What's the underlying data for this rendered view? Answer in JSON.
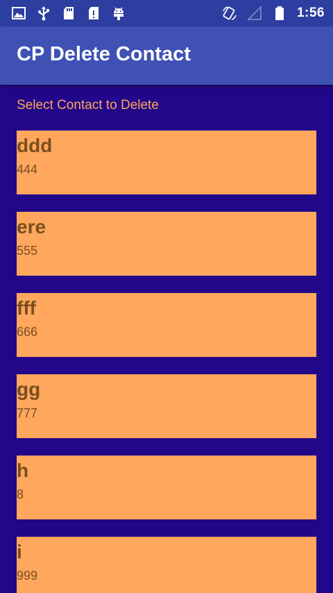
{
  "status_bar": {
    "time": "1:56",
    "left_icons": [
      "image-icon",
      "usb-icon",
      "sd-card-icon",
      "sd-card-alert-icon",
      "android-debug-icon"
    ],
    "right_icons": [
      "screen-rotation-icon",
      "signal-icon",
      "battery-icon"
    ]
  },
  "app_bar": {
    "title": "CP Delete Contact",
    "color": "#3f51b5"
  },
  "main": {
    "prompt": "Select Contact to Delete",
    "background": "#23078a",
    "item_color": "#ffa75c",
    "contacts": [
      {
        "name": "ddd",
        "number": "444"
      },
      {
        "name": "ere",
        "number": "555"
      },
      {
        "name": "fff",
        "number": "666"
      },
      {
        "name": "gg",
        "number": "777"
      },
      {
        "name": "h",
        "number": "8"
      },
      {
        "name": "i",
        "number": "999"
      }
    ]
  }
}
